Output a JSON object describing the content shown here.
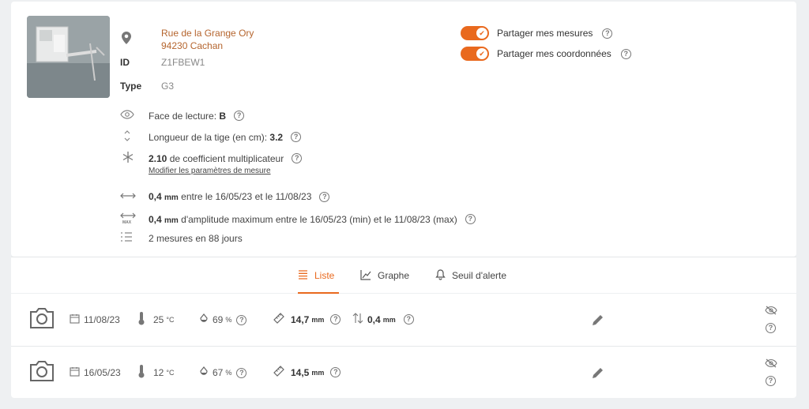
{
  "sensor": {
    "address_line1": "Rue de la Grange Ory",
    "address_line2": "94230 Cachan",
    "id_label": "ID",
    "id_value": "Z1FBEW1",
    "type_label": "Type",
    "type_value": "G3"
  },
  "sharing": {
    "share_measures": "Partager mes mesures",
    "share_coords": "Partager mes coordonnées"
  },
  "params": {
    "face_prefix": "Face de lecture: ",
    "face_value": "B",
    "length_prefix": "Longueur de la tige (en cm): ",
    "length_value": "3.2",
    "coef_value": "2.10",
    "coef_suffix": " de coefficient multiplicateur",
    "modify_link": "Modifier les paramètres de mesure"
  },
  "stats": {
    "variation_value": "0,4",
    "variation_unit": "mm",
    "variation_text": " entre le 16/05/23 et le 11/08/23",
    "amplitude_value": "0,4",
    "amplitude_unit": "mm",
    "amplitude_text": " d'amplitude maximum entre le 16/05/23 (min) et le 11/08/23 (max)",
    "amplitude_icon_label": "MAX",
    "count_text": "2 mesures en 88 jours"
  },
  "tabs": [
    {
      "label": "Liste",
      "active": true
    },
    {
      "label": "Graphe",
      "active": false
    },
    {
      "label": "Seuil d'alerte",
      "active": false
    }
  ],
  "measures": [
    {
      "date": "11/08/23",
      "temp": "25",
      "temp_unit": "°C",
      "humidity": "69",
      "humidity_unit": "%",
      "width": "14,7",
      "width_unit": "mm",
      "delta": "0,4",
      "delta_unit": "mm"
    },
    {
      "date": "16/05/23",
      "temp": "12",
      "temp_unit": "°C",
      "humidity": "67",
      "humidity_unit": "%",
      "width": "14,5",
      "width_unit": "mm"
    }
  ],
  "help_symbol": "?",
  "colors": {
    "accent": "#e9691e",
    "address": "#b5652e"
  }
}
